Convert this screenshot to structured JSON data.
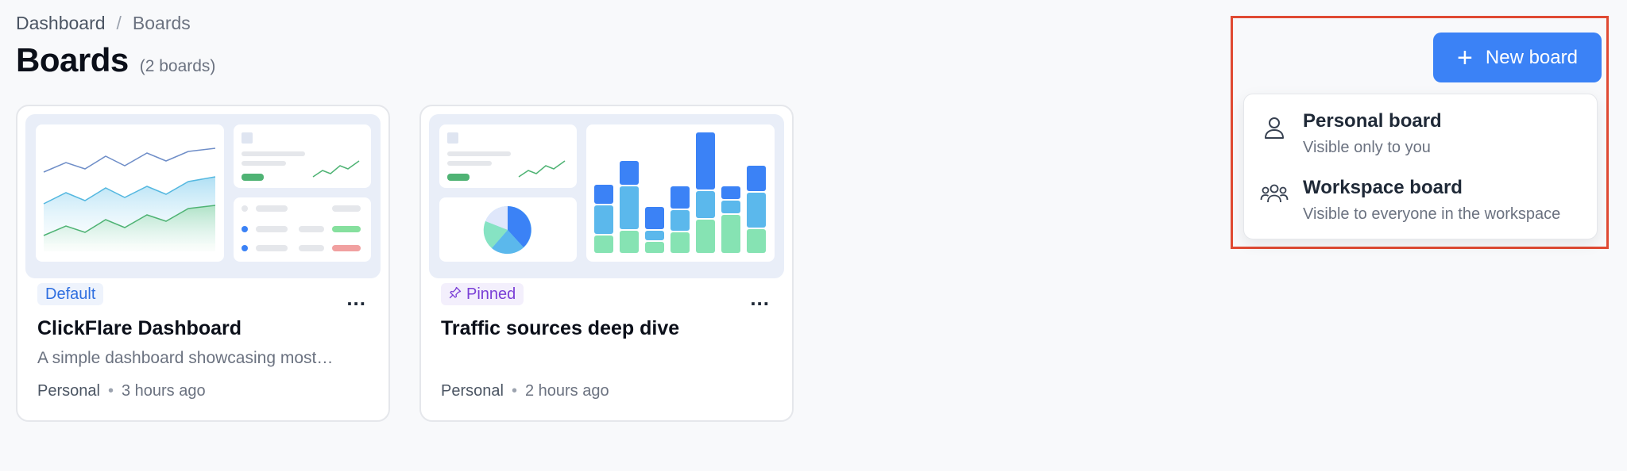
{
  "breadcrumb": {
    "root": "Dashboard",
    "separator": "/",
    "current": "Boards"
  },
  "header": {
    "title": "Boards",
    "count": "(2 boards)"
  },
  "actions": {
    "new_board_label": "New board",
    "plus_icon": "plus-icon"
  },
  "dropdown": {
    "items": [
      {
        "icon": "person-icon",
        "title": "Personal board",
        "subtitle": "Visible only to you"
      },
      {
        "icon": "users-icon",
        "title": "Workspace board",
        "subtitle": "Visible to everyone in the workspace"
      }
    ]
  },
  "boards": [
    {
      "badge": "Default",
      "name": "ClickFlare Dashboard",
      "description": "A simple dashboard showcasing most…",
      "owner": "Personal",
      "time": "3 hours ago",
      "more_label": "..."
    },
    {
      "badge": "Pinned",
      "badge_icon": "pin-icon",
      "name": "Traffic sources deep dive",
      "description": "",
      "owner": "Personal",
      "time": "2 hours ago",
      "more_label": "..."
    }
  ],
  "meta_separator": "•",
  "colors": {
    "accent": "#3b82f6",
    "highlight": "#e04a33",
    "default_badge": "#2f6fe0",
    "pinned_badge": "#7a3fd6"
  }
}
